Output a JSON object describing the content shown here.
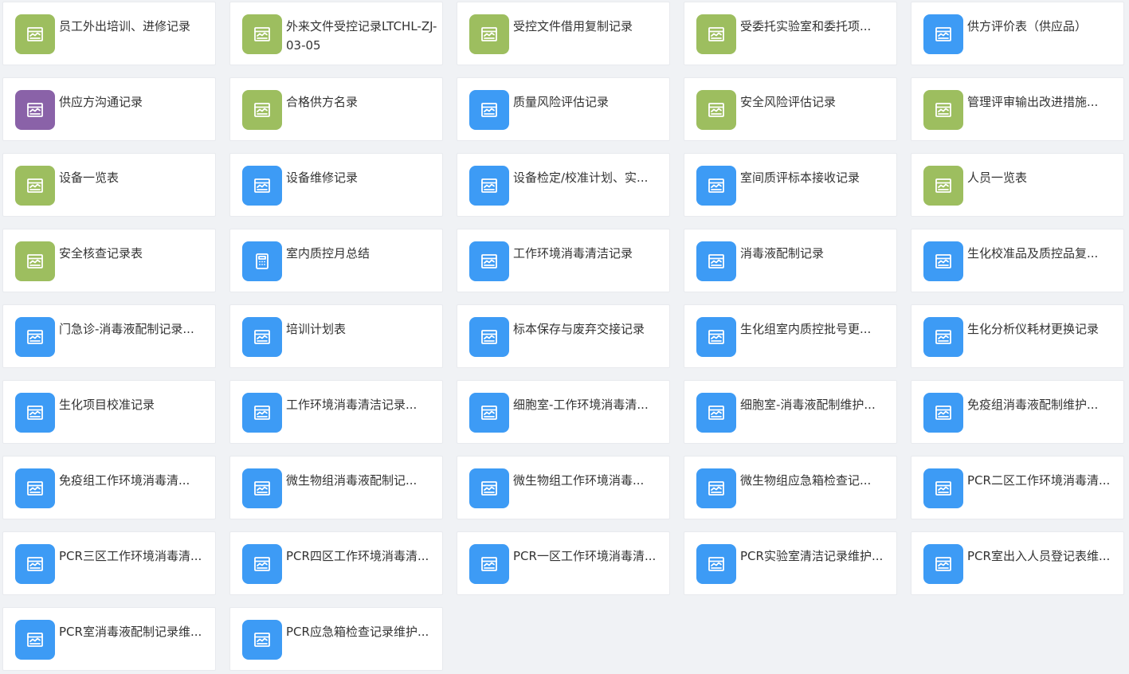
{
  "colors": {
    "green": "#9dbe5f",
    "blue": "#3d9bf5",
    "purple": "#8a62a8",
    "background": "#f0f2f5",
    "card": "#ffffff",
    "text": "#333333"
  },
  "items": [
    {
      "label": "员工外出培训、进修记录",
      "color": "green",
      "icon": "form-icon"
    },
    {
      "label": "外来文件受控记录LTCHL-ZJ-03-05",
      "color": "green",
      "icon": "form-icon",
      "multi": true
    },
    {
      "label": "受控文件借用复制记录",
      "color": "green",
      "icon": "form-icon"
    },
    {
      "label": "受委托实验室和委托项...",
      "color": "green",
      "icon": "form-icon"
    },
    {
      "label": "供方评价表（供应品）",
      "color": "blue",
      "icon": "form-icon"
    },
    {
      "label": "供应方沟通记录",
      "color": "purple",
      "icon": "form-icon"
    },
    {
      "label": "合格供方名录",
      "color": "green",
      "icon": "form-icon"
    },
    {
      "label": "质量风险评估记录",
      "color": "blue",
      "icon": "form-icon"
    },
    {
      "label": "安全风险评估记录",
      "color": "green",
      "icon": "form-icon"
    },
    {
      "label": "管理评审输出改进措施...",
      "color": "green",
      "icon": "form-icon"
    },
    {
      "label": "设备一览表",
      "color": "green",
      "icon": "form-icon"
    },
    {
      "label": "设备维修记录",
      "color": "blue",
      "icon": "form-icon"
    },
    {
      "label": "设备检定/校准计划、实...",
      "color": "blue",
      "icon": "form-icon"
    },
    {
      "label": "室间质评标本接收记录",
      "color": "blue",
      "icon": "form-icon"
    },
    {
      "label": "人员一览表",
      "color": "green",
      "icon": "form-icon"
    },
    {
      "label": "安全核查记录表",
      "color": "green",
      "icon": "form-icon"
    },
    {
      "label": "室内质控月总结",
      "color": "blue",
      "icon": "calculator-icon"
    },
    {
      "label": "工作环境消毒清洁记录",
      "color": "blue",
      "icon": "form-icon"
    },
    {
      "label": "消毒液配制记录",
      "color": "blue",
      "icon": "form-icon"
    },
    {
      "label": "生化校准品及质控品复...",
      "color": "blue",
      "icon": "form-icon"
    },
    {
      "label": "门急诊-消毒液配制记录...",
      "color": "blue",
      "icon": "form-icon"
    },
    {
      "label": "培训计划表",
      "color": "blue",
      "icon": "form-icon"
    },
    {
      "label": "标本保存与废弃交接记录",
      "color": "blue",
      "icon": "form-icon"
    },
    {
      "label": "生化组室内质控批号更...",
      "color": "blue",
      "icon": "form-icon"
    },
    {
      "label": "生化分析仪耗材更换记录",
      "color": "blue",
      "icon": "form-icon"
    },
    {
      "label": "生化项目校准记录",
      "color": "blue",
      "icon": "form-icon"
    },
    {
      "label": "工作环境消毒清洁记录...",
      "color": "blue",
      "icon": "form-icon"
    },
    {
      "label": "细胞室-工作环境消毒清...",
      "color": "blue",
      "icon": "form-icon"
    },
    {
      "label": "细胞室-消毒液配制维护...",
      "color": "blue",
      "icon": "form-icon"
    },
    {
      "label": "免疫组消毒液配制维护...",
      "color": "blue",
      "icon": "form-icon"
    },
    {
      "label": "免疫组工作环境消毒清...",
      "color": "blue",
      "icon": "form-icon"
    },
    {
      "label": "微生物组消毒液配制记...",
      "color": "blue",
      "icon": "form-icon"
    },
    {
      "label": "微生物组工作环境消毒...",
      "color": "blue",
      "icon": "form-icon"
    },
    {
      "label": "微生物组应急箱检查记...",
      "color": "blue",
      "icon": "form-icon"
    },
    {
      "label": "PCR二区工作环境消毒清...",
      "color": "blue",
      "icon": "form-icon"
    },
    {
      "label": "PCR三区工作环境消毒清...",
      "color": "blue",
      "icon": "form-icon"
    },
    {
      "label": "PCR四区工作环境消毒清...",
      "color": "blue",
      "icon": "form-icon"
    },
    {
      "label": "PCR一区工作环境消毒清...",
      "color": "blue",
      "icon": "form-icon"
    },
    {
      "label": "PCR实验室清洁记录维护...",
      "color": "blue",
      "icon": "form-icon"
    },
    {
      "label": "PCR室出入人员登记表维...",
      "color": "blue",
      "icon": "form-icon"
    },
    {
      "label": "PCR室消毒液配制记录维...",
      "color": "blue",
      "icon": "form-icon"
    },
    {
      "label": "PCR应急箱检查记录维护...",
      "color": "blue",
      "icon": "form-icon"
    }
  ]
}
